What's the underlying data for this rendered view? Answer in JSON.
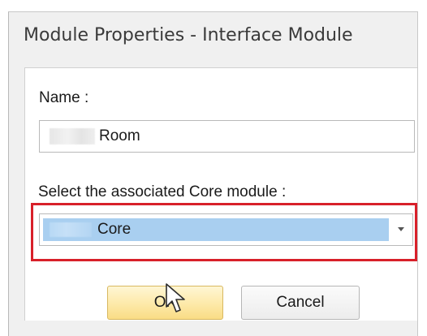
{
  "dialog": {
    "title": "Module Properties - Interface Module"
  },
  "name_field": {
    "label": "Name :",
    "value": "Room"
  },
  "core_select": {
    "label": "Select the associated Core module :",
    "selected_value": "Core",
    "highlight_color": "#d8202a",
    "selection_color": "#a9cff0"
  },
  "buttons": {
    "ok_label": "OK",
    "cancel_label": "Cancel"
  },
  "icons": {
    "cursor": "mouse-pointer-icon",
    "dropdown": "chevron-down-icon"
  }
}
